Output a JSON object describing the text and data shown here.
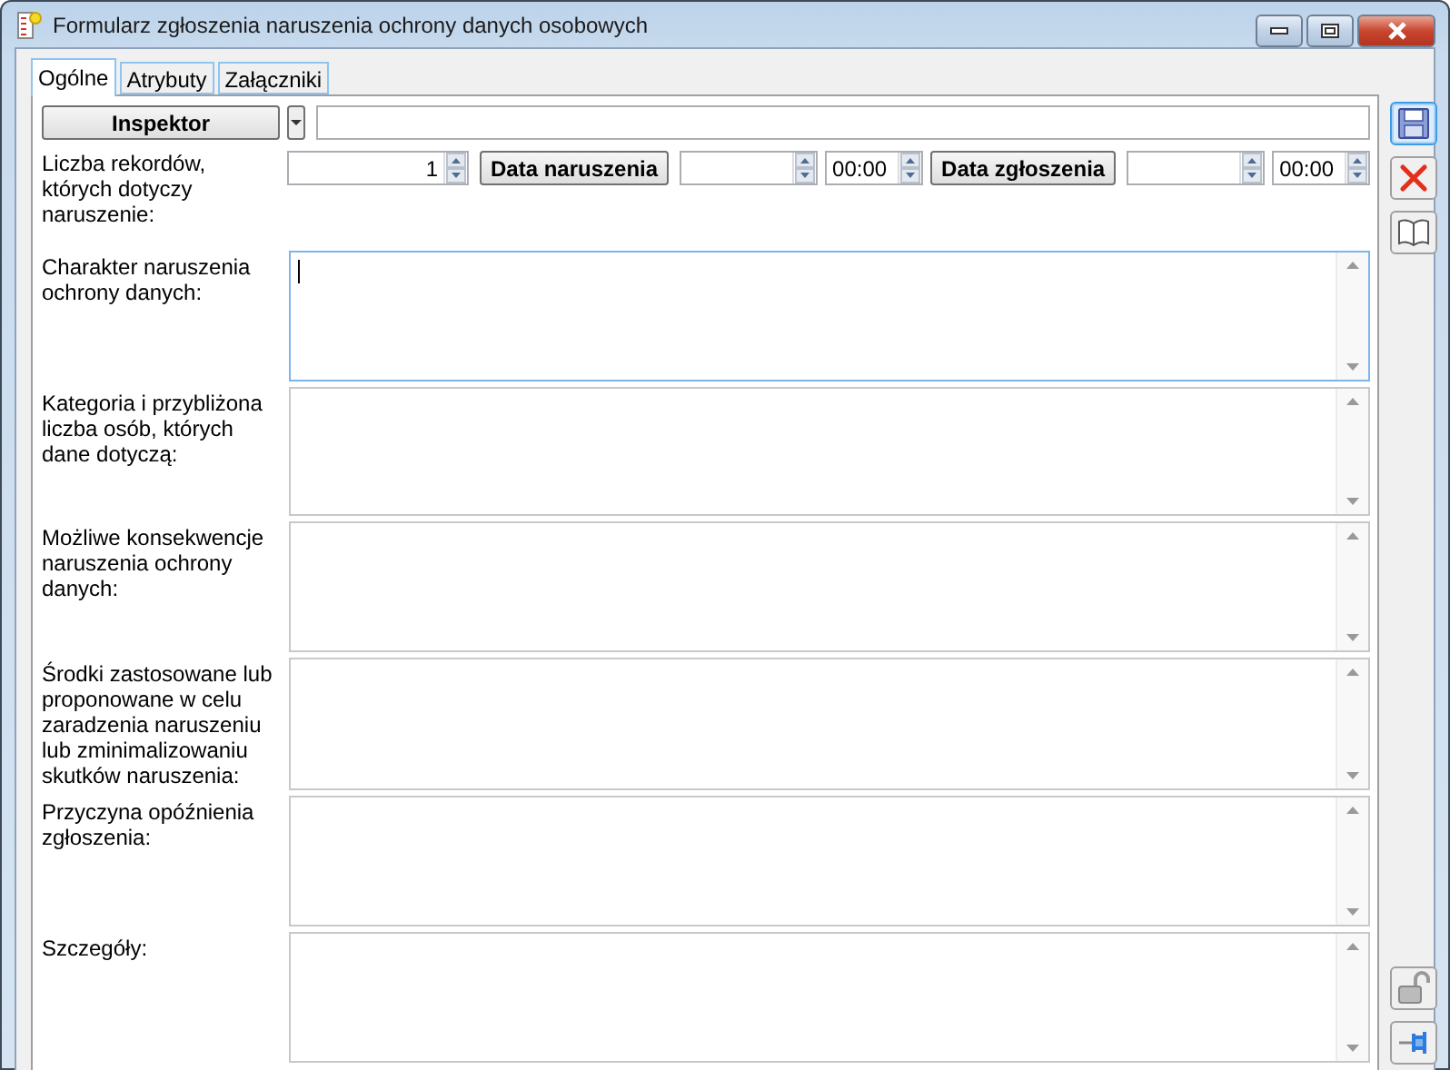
{
  "window": {
    "title": "Formularz zgłoszenia naruszenia ochrony danych osobowych"
  },
  "tabs": [
    {
      "label": "Ogólne",
      "selected": true
    },
    {
      "label": "Atrybuty",
      "selected": false
    },
    {
      "label": "Załączniki",
      "selected": false
    }
  ],
  "inspector": {
    "button": "Inspektor"
  },
  "records": {
    "label": "Liczba rekordów, których dotyczy naruszenie:",
    "count": "1",
    "breach_date_button": "Data naruszenia",
    "breach_time": "00:00",
    "report_date_button": "Data zgłoszenia",
    "report_time": "00:00"
  },
  "text_areas": [
    {
      "label": "Charakter naruszenia ochrony danych:",
      "focused": true
    },
    {
      "label": "Kategoria i przybliżona liczba osób, których dane dotyczą:",
      "focused": false
    },
    {
      "label": "Możliwe konsekwencje naruszenia ochrony danych:",
      "focused": false
    },
    {
      "label": "Środki zastosowane lub proponowane w celu zaradzenia naruszeniu lub zminimalizowaniu skutków naruszenia:",
      "focused": false
    },
    {
      "label": "Przyczyna opóźnienia zgłoszenia:",
      "focused": false
    },
    {
      "label": "Szczegóły:",
      "focused": false
    }
  ],
  "toolbar_top": [
    {
      "kind": "save",
      "highlighted": true
    },
    {
      "kind": "delete",
      "highlighted": false
    },
    {
      "kind": "book",
      "highlighted": false
    }
  ],
  "toolbar_bottom": [
    {
      "kind": "lock",
      "highlighted": false
    },
    {
      "kind": "pin",
      "highlighted": false
    }
  ]
}
